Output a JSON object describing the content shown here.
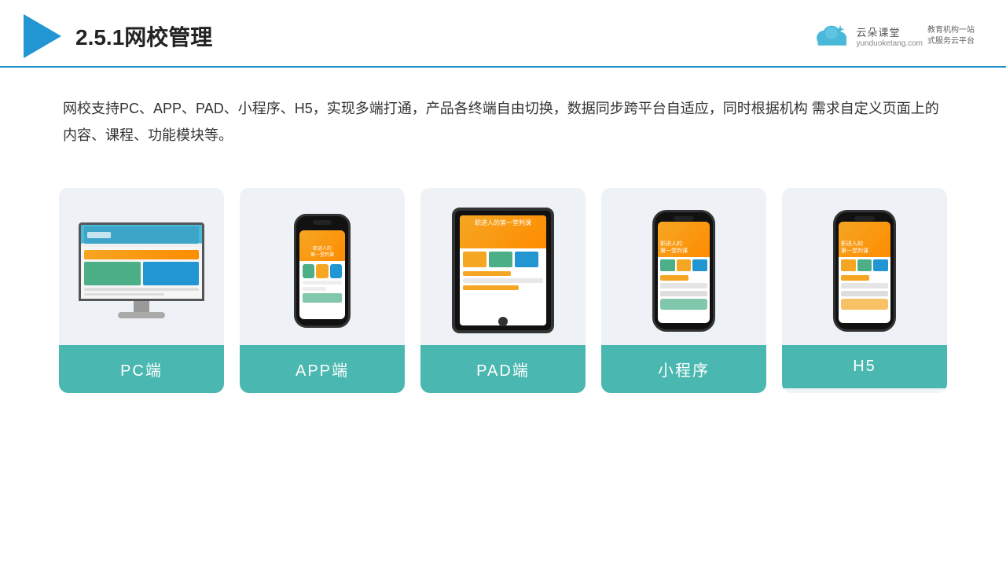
{
  "header": {
    "title": "2.5.1网校管理",
    "brand": {
      "name": "云朵课堂",
      "url": "yunduoketang.com",
      "tagline": "教育机构一站\n式服务云平台"
    }
  },
  "description": "网校支持PC、APP、PAD、小程序、H5，实现多端打通，产品各终端自由切换，数据同步跨平台自适应，同时根据机构\n需求自定义页面上的内容、课程、功能模块等。",
  "cards": [
    {
      "id": "pc",
      "label": "PC端"
    },
    {
      "id": "app",
      "label": "APP端"
    },
    {
      "id": "pad",
      "label": "PAD端"
    },
    {
      "id": "miniprogram",
      "label": "小程序"
    },
    {
      "id": "h5",
      "label": "H5"
    }
  ]
}
